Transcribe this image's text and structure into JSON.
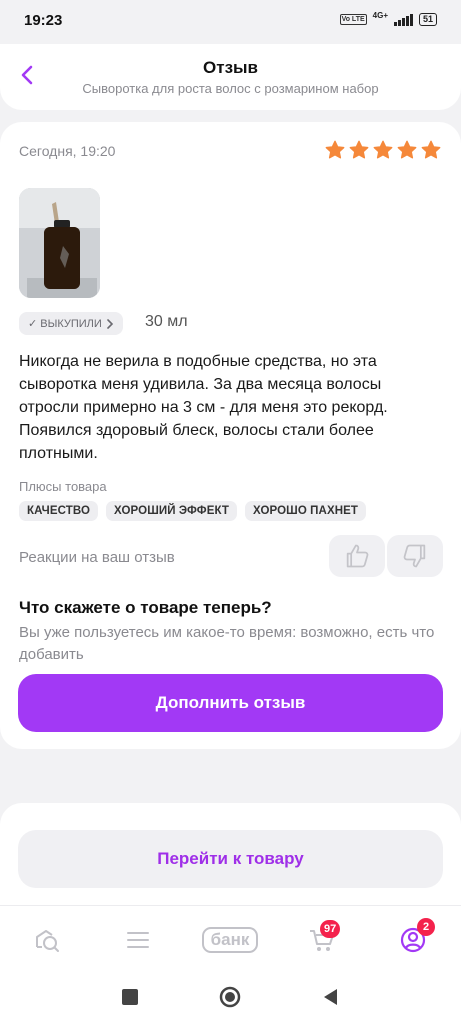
{
  "status_bar": {
    "time": "19:23",
    "volte": "Vo LTE",
    "network": "4G+",
    "battery": "51"
  },
  "header": {
    "title": "Отзыв",
    "subtitle": "Сыворотка для роста волос с розмарином набор",
    "back_icon": "chevron-left-icon"
  },
  "review": {
    "date": "Сегодня, 19:20",
    "rating": 5,
    "rating_max": 5,
    "bought_label": "✓ ВЫКУПИЛИ",
    "size": "30 мл",
    "text": "Никогда не верила в подобные средства, но эта сыворотка меня удивила. За два месяца волосы отросли примерно на 3 см - для меня это рекорд. Появился здоровый блеск, волосы стали более плотными.",
    "pros_label": "Плюсы товара",
    "pros": [
      "КАЧЕСТВО",
      "ХОРОШИЙ ЭФФЕКТ",
      "ХОРОШО ПАХНЕТ"
    ],
    "reactions_label": "Реакции на ваш отзыв"
  },
  "followup": {
    "title": "Что скажете о товаре теперь?",
    "subtitle": "Вы уже пользуетесь им какое-то время: возможно, есть что добавить",
    "button": "Дополнить отзыв"
  },
  "goto_button": "Перейти к товару",
  "tabbar": {
    "bank_label": "банк",
    "cart_badge": "97",
    "profile_badge": "2"
  },
  "colors": {
    "accent": "#a239f5",
    "star": "#f5883a",
    "badge": "#f4224c"
  }
}
